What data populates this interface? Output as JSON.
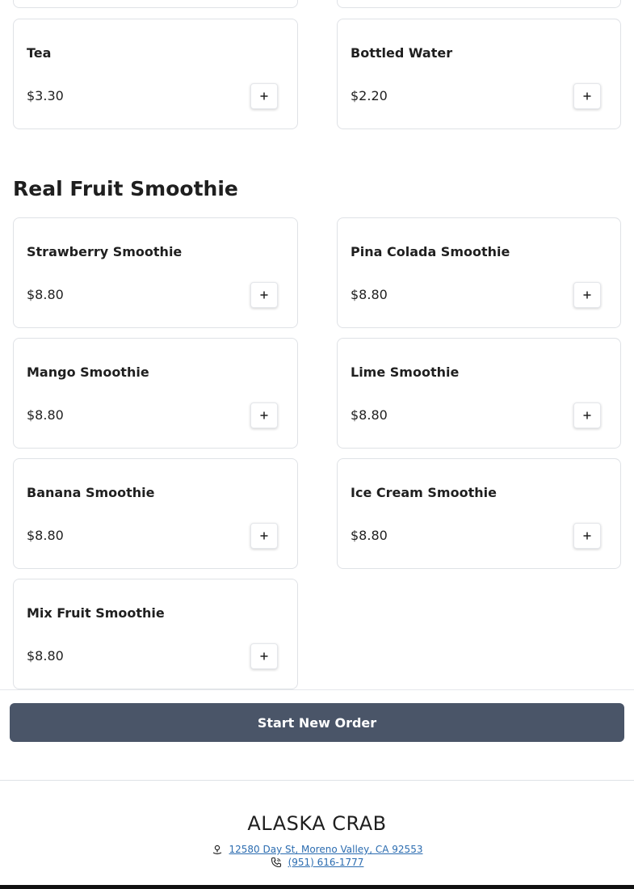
{
  "beverages": {
    "items": [
      {
        "name": "Tea",
        "price": "$3.30"
      },
      {
        "name": "Bottled Water",
        "price": "$2.20"
      }
    ]
  },
  "smoothies": {
    "title": "Real Fruit Smoothie",
    "items": [
      {
        "name": "Strawberry Smoothie",
        "price": "$8.80"
      },
      {
        "name": "Pina Colada Smoothie",
        "price": "$8.80"
      },
      {
        "name": "Mango Smoothie",
        "price": "$8.80"
      },
      {
        "name": "Lime Smoothie",
        "price": "$8.80"
      },
      {
        "name": "Banana Smoothie",
        "price": "$8.80"
      },
      {
        "name": "Ice Cream Smoothie",
        "price": "$8.80"
      },
      {
        "name": "Mix Fruit Smoothie",
        "price": "$8.80"
      }
    ]
  },
  "order": {
    "start_label": "Start New Order"
  },
  "footer": {
    "brand": "ALASKA CRAB",
    "address": "12580 Day St, Moreno Valley, CA 92553",
    "phone": "(951) 616-1777",
    "address_icon": "location-pin-icon",
    "phone_icon": "phone-icon"
  },
  "colors": {
    "primary_button": "#4a5568",
    "link": "#2b6cb0",
    "card_border": "#dfe2e6"
  }
}
